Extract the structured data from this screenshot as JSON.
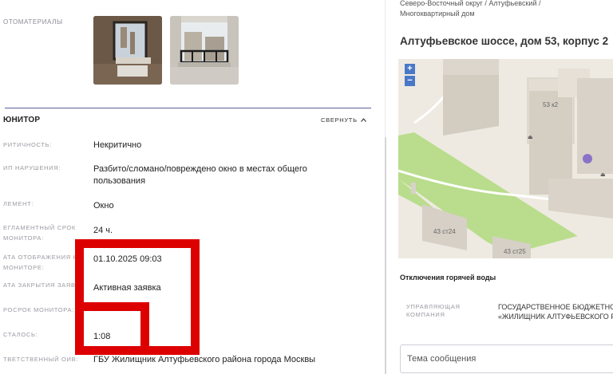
{
  "photos": {
    "label": "ОТОМАТЕРИАЛЫ"
  },
  "monitor": {
    "title": "ЮНИТОР",
    "collapse_label": "СВЕРНУТЬ",
    "rows": [
      {
        "label": "РИТИЧНОСТЬ:",
        "value": "Некритично"
      },
      {
        "label": "ИП НАРУШЕНИЯ:",
        "value": "Разбито/сломано/повреждено окно в местах общего пользования"
      },
      {
        "label": "ЛЕМЕНТ:",
        "value": "Окно"
      },
      {
        "label": "ЕГЛАМЕНТНЫЙ СРОК МОНИТОРА:",
        "value": "24 ч."
      },
      {
        "label": "АТА ОТОБРАЖЕНИЯ НА МОНИТОРЕ:",
        "value": "01.10.2025 09:03"
      },
      {
        "label": "АТА ЗАКРЫТИЯ ЗАЯВКИ",
        "value": "Активная заявка"
      },
      {
        "label": "РОСРОК МОНИТОРА:",
        "value": ""
      },
      {
        "label": "СТАЛОСЬ:",
        "value": "1:08"
      },
      {
        "label": "ТВЕТСТВЕННЫЙ ОИВ:",
        "value": "ГБУ Жилищник Алтуфьевского района города Москвы"
      }
    ]
  },
  "location": {
    "breadcrumb": "Северо-Восточный округ / Алтуфьевский / Многоквартирный дом",
    "title": "Алтуфьевское шоссе, дом 53, корпус 2"
  },
  "map": {
    "zoom_in": "+",
    "zoom_out": "−",
    "labels": [
      "53 к2",
      "43 ст24",
      "43 ст25"
    ]
  },
  "outage": {
    "title": "Отключения горячей воды"
  },
  "org": {
    "label": "УПРАВЛЯЮЩАЯ КОМПАНИЯ",
    "value_line1": "ГОСУДАРСТВЕННОЕ БЮДЖЕТНОЕ",
    "value_line2": "«ЖИЛИЩНИК АЛТУФЬЕВСКОГО РА"
  },
  "message": {
    "placeholder": "Тема сообщения"
  },
  "colors": {
    "accent": "#4a78c8",
    "highlight": "#dd0000",
    "section_line": "#5b5f96",
    "map_dot": "#8a72c9"
  }
}
